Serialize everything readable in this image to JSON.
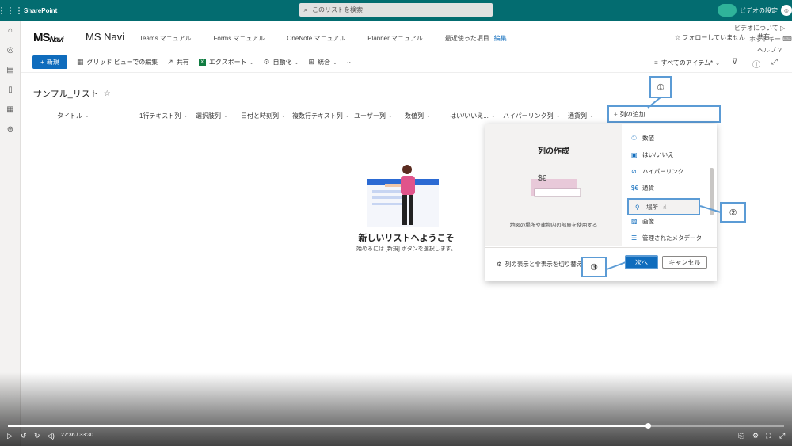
{
  "suite": {
    "brand": "SharePoint",
    "search_placeholder": "このリストを検索",
    "video_settings": "ビデオの設定"
  },
  "site": {
    "logo_letters": "MS",
    "logo_navi": "Navi",
    "name": "MS Navi",
    "nav": [
      "Teams マニュアル",
      "Forms マニュアル",
      "OneNote マニュアル",
      "Planner マニュアル",
      "最近使った項目"
    ],
    "edit": "編集",
    "follow": "☆ フォローしていません",
    "share": "共有"
  },
  "overlay": {
    "about_video": "ビデオについて",
    "hotkeys": "ホットキー",
    "help": "ヘルプ"
  },
  "commandbar": {
    "new": "新規",
    "grid_edit": "グリッド ビューでの編集",
    "share": "共有",
    "export": "エクスポート",
    "automate": "自動化",
    "integrate": "統合",
    "more": "···",
    "view": "すべてのアイテム*"
  },
  "list": {
    "title": "サンプル_リスト",
    "columns": [
      "タイトル",
      "1行テキスト列",
      "選択肢列",
      "日付と時刻列",
      "複数行テキスト列",
      "ユーザー列",
      "数値列",
      "はい/いいえ...",
      "ハイパーリンク列",
      "通貨列"
    ],
    "add_column": "列の追加"
  },
  "empty_state": {
    "title": "新しいリストへようこそ",
    "subtitle": "始めるには [新規] ボタンを選択します。"
  },
  "panel": {
    "title": "列の作成",
    "preview_symbol": "$€",
    "description": "地図の場所や建物内の部屋を使用する",
    "types": [
      {
        "icon": "number-icon",
        "glyph": "①",
        "label": "数値"
      },
      {
        "icon": "yesno-icon",
        "glyph": "▣",
        "label": "はい/いいえ"
      },
      {
        "icon": "link-icon",
        "glyph": "⊘",
        "label": "ハイパーリンク"
      },
      {
        "icon": "currency-icon",
        "glyph": "$€",
        "label": "通貨"
      },
      {
        "icon": "location-icon",
        "glyph": "⚲",
        "label": "場所"
      },
      {
        "icon": "image-icon",
        "glyph": "▨",
        "label": "画像"
      },
      {
        "icon": "managed-metadata-icon",
        "glyph": "☰",
        "label": "管理されたメタデータ"
      }
    ],
    "footer_toggle": "列の表示と非表示を切り替え",
    "next": "次へ",
    "cancel": "キャンセル"
  },
  "callouts": [
    "①",
    "②",
    "③"
  ],
  "player": {
    "time": "27:36 / 33:30",
    "progress": 0.824
  }
}
